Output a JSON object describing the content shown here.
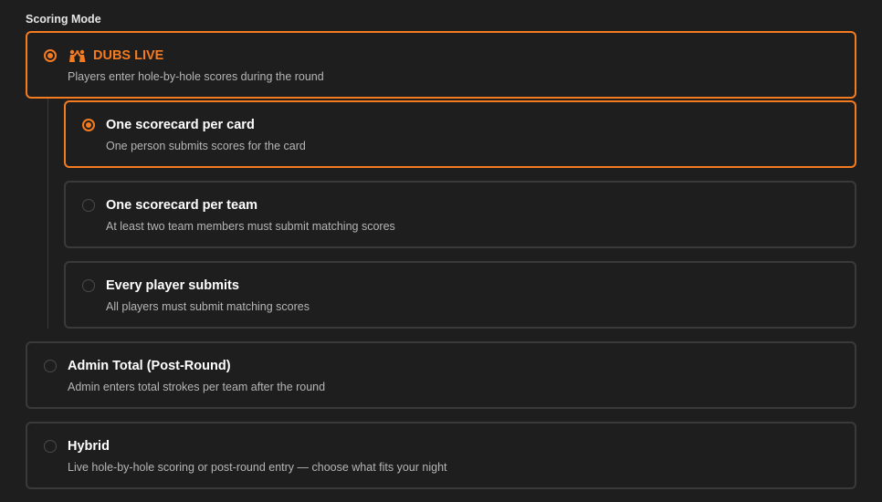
{
  "section_label": "Scoring Mode",
  "colors": {
    "accent": "#f47b20",
    "border": "#3a3a3a",
    "background": "#1e1e1e"
  },
  "options": {
    "dubs_live": {
      "icon": "group-high-five-icon",
      "title": "DUBS LIVE",
      "description": "Players enter hole-by-hole scores during the round",
      "selected": true
    },
    "per_card": {
      "title": "One scorecard per card",
      "description": "One person submits scores for the card",
      "selected": true
    },
    "per_team": {
      "title": "One scorecard per team",
      "description": "At least two team members must submit matching scores",
      "selected": false
    },
    "every_player": {
      "title": "Every player submits",
      "description": "All players must submit matching scores",
      "selected": false
    },
    "admin_total": {
      "title": "Admin Total (Post-Round)",
      "description": "Admin enters total strokes per team after the round",
      "selected": false
    },
    "hybrid": {
      "title": "Hybrid",
      "description": "Live hole-by-hole scoring or post-round entry — choose what fits your night",
      "selected": false
    }
  }
}
